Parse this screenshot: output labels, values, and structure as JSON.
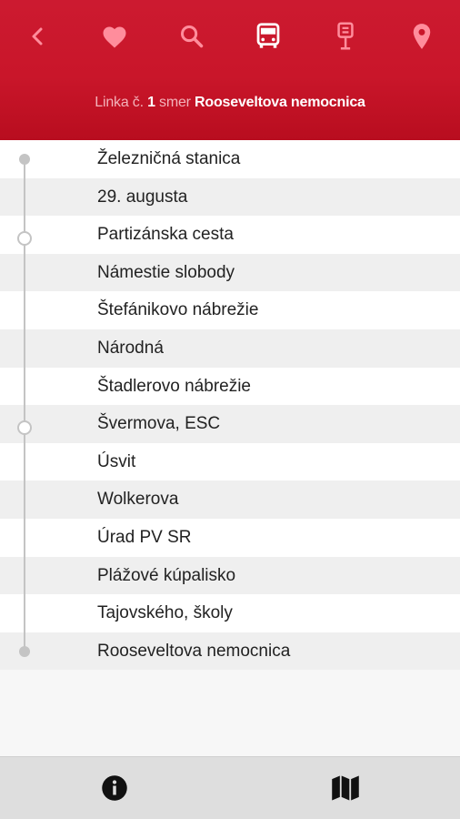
{
  "nav": {
    "icons": [
      "back-arrow-icon",
      "heart-icon",
      "search-icon",
      "bus-icon",
      "bus-stop-icon",
      "map-pin-icon"
    ],
    "icon_color": "#ff8d9c",
    "active_icon_color": "#ffffff"
  },
  "subtitle": {
    "line_prefix": "Linka č.",
    "line_number": "1",
    "direction_prefix": "smer",
    "destination": "Rooseveltova nemocnica"
  },
  "stops": [
    {
      "name": "Železničná stanica",
      "marker": "end"
    },
    {
      "name": "29. augusta",
      "marker": "none"
    },
    {
      "name": "Partizánska cesta",
      "marker": "none"
    },
    {
      "name": "Námestie slobody",
      "marker": "transfer"
    },
    {
      "name": "Štefánikovo nábrežie",
      "marker": "none"
    },
    {
      "name": "Národná",
      "marker": "none"
    },
    {
      "name": "Štadlerovo nábrežie",
      "marker": "none"
    },
    {
      "name": "Švermova, ESC",
      "marker": "none"
    },
    {
      "name": "Úsvit",
      "marker": "transfer"
    },
    {
      "name": "Wolkerova",
      "marker": "none"
    },
    {
      "name": "Úrad PV SR",
      "marker": "none"
    },
    {
      "name": "Plážové kúpalisko",
      "marker": "none"
    },
    {
      "name": "Tajovského, školy",
      "marker": "none"
    },
    {
      "name": "Rooseveltova nemocnica",
      "marker": "end"
    }
  ],
  "footer": {
    "icons": [
      "info-icon",
      "map-icon"
    ]
  },
  "colors": {
    "header": "#c9162a",
    "route_line": "#c4c4c4"
  }
}
